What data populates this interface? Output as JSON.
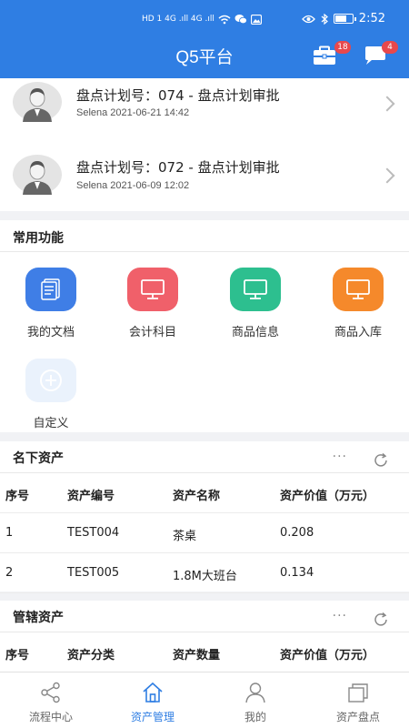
{
  "status_bar": {
    "network": "HD 1  4G .ıll 4G .ıll",
    "time": "2:52"
  },
  "header": {
    "title": "Q5平台",
    "briefcase_badge": "18",
    "chat_badge": "4"
  },
  "messages": [
    {
      "title": "盘点计划号：074 - 盘点计划审批",
      "meta": "Selena 2021-06-21 14:42"
    },
    {
      "title": "盘点计划号：072 - 盘点计划审批",
      "meta": "Selena 2021-06-09 12:02"
    }
  ],
  "common_functions": {
    "title": "常用功能",
    "items": [
      {
        "label": "我的文档",
        "icon": "document-icon",
        "color": "#3f7ee6"
      },
      {
        "label": "会计科目",
        "icon": "monitor-icon",
        "color": "#f0606a"
      },
      {
        "label": "商品信息",
        "icon": "monitor-icon",
        "color": "#2dbf8f"
      },
      {
        "label": "商品入库",
        "icon": "monitor-icon",
        "color": "#f5892b"
      },
      {
        "label": "自定义",
        "icon": "plus-circle-icon",
        "color": "#eaf2fc"
      }
    ]
  },
  "owned_assets": {
    "title": "名下资产",
    "more": "···",
    "headers": [
      "序号",
      "资产编号",
      "资产名称",
      "资产价值（万元）"
    ],
    "rows": [
      [
        "1",
        "TEST004",
        "茶桌",
        "0.208"
      ],
      [
        "2",
        "TEST005",
        "1.8M大班台",
        "0.134"
      ]
    ]
  },
  "managed_assets": {
    "title": "管辖资产",
    "more": "···",
    "headers": [
      "序号",
      "资产分类",
      "资产数量",
      "资产价值（万元）"
    ]
  },
  "tabs": [
    {
      "label": "流程中心",
      "icon": "share-icon",
      "active": false
    },
    {
      "label": "资产管理",
      "icon": "home-icon",
      "active": true
    },
    {
      "label": "我的",
      "icon": "user-icon",
      "active": false
    },
    {
      "label": "资产盘点",
      "icon": "stack-icon",
      "active": false
    }
  ],
  "colors": {
    "primary": "#2f7ee3",
    "badge": "#e8484c"
  }
}
